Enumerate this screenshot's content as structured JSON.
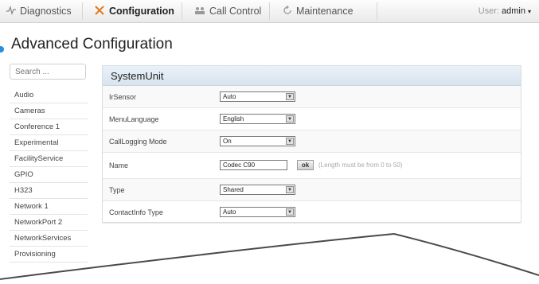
{
  "nav": {
    "tabs": [
      {
        "label": "Diagnostics",
        "icon": "pulse-icon"
      },
      {
        "label": "Configuration",
        "icon": "wrench-icon"
      },
      {
        "label": "Call Control",
        "icon": "users-icon"
      },
      {
        "label": "Maintenance",
        "icon": "refresh-icon"
      }
    ],
    "user_prefix": "User:",
    "user_name": "admin"
  },
  "page": {
    "title": "Advanced Configuration"
  },
  "search": {
    "placeholder": "Search ..."
  },
  "sidebar": {
    "items": [
      {
        "label": "Audio"
      },
      {
        "label": "Cameras"
      },
      {
        "label": "Conference 1"
      },
      {
        "label": "Experimental"
      },
      {
        "label": "FacilityService"
      },
      {
        "label": "GPIO"
      },
      {
        "label": "H323"
      },
      {
        "label": "Network 1"
      },
      {
        "label": "NetworkPort 2"
      },
      {
        "label": "NetworkServices"
      },
      {
        "label": "Provisioning"
      }
    ]
  },
  "panel": {
    "title": "SystemUnit",
    "rows": [
      {
        "label": "IrSensor",
        "value": "Auto"
      },
      {
        "label": "MenuLanguage",
        "value": "English"
      },
      {
        "label": "CallLogging Mode",
        "value": "On"
      },
      {
        "label": "Name",
        "value": "Codec C90",
        "button": "ok",
        "hint": "(Length must be from 0 to 50)"
      },
      {
        "label": "Type",
        "value": "Shared"
      },
      {
        "label": "ContactInfo Type",
        "value": "Auto"
      }
    ]
  },
  "colors": {
    "accent": "#2a8ddc",
    "active_tab_icon": "#e2791b"
  }
}
